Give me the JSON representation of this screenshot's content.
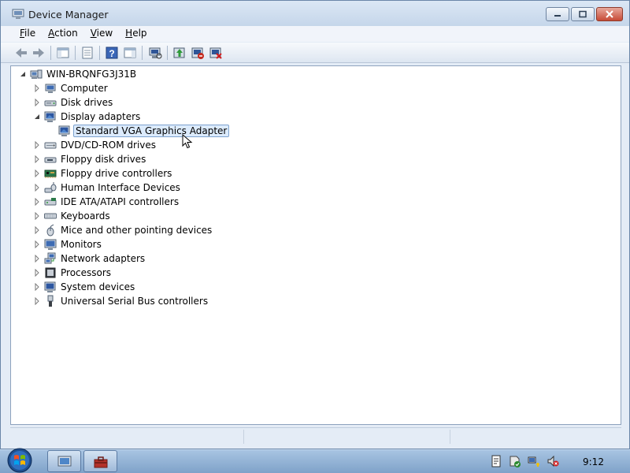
{
  "window": {
    "title": "Device Manager",
    "icon": "device-manager-icon"
  },
  "menu": [
    {
      "label": "File",
      "accel": "F",
      "rest": "ile"
    },
    {
      "label": "Action",
      "accel": "A",
      "rest": "ction"
    },
    {
      "label": "View",
      "accel": "V",
      "rest": "iew"
    },
    {
      "label": "Help",
      "accel": "H",
      "rest": "elp"
    }
  ],
  "toolbar": {
    "buttons": [
      "back-icon",
      "forward-icon",
      "show-hide-console-tree-icon",
      "properties-icon",
      "help-icon",
      "show-hide-action-pane-icon",
      "scan-hardware-icon",
      "update-driver-icon",
      "disable-device-icon",
      "uninstall-device-icon"
    ]
  },
  "tree": {
    "root": "WIN-BRQNFG3J31B",
    "categories": [
      {
        "label": "Computer",
        "expanded": false,
        "icon": "computer-icon"
      },
      {
        "label": "Disk drives",
        "expanded": false,
        "icon": "disk-drive-icon"
      },
      {
        "label": "Display adapters",
        "expanded": true,
        "icon": "display-adapter-icon",
        "children": [
          {
            "label": "Standard VGA Graphics Adapter",
            "selected": true,
            "icon": "display-adapter-icon"
          }
        ]
      },
      {
        "label": "DVD/CD-ROM drives",
        "expanded": false,
        "icon": "dvd-drive-icon"
      },
      {
        "label": "Floppy disk drives",
        "expanded": false,
        "icon": "floppy-drive-icon"
      },
      {
        "label": "Floppy drive controllers",
        "expanded": false,
        "icon": "floppy-controller-icon"
      },
      {
        "label": "Human Interface Devices",
        "expanded": false,
        "icon": "hid-icon"
      },
      {
        "label": "IDE ATA/ATAPI controllers",
        "expanded": false,
        "icon": "ide-controller-icon"
      },
      {
        "label": "Keyboards",
        "expanded": false,
        "icon": "keyboard-icon"
      },
      {
        "label": "Mice and other pointing devices",
        "expanded": false,
        "icon": "mouse-icon"
      },
      {
        "label": "Monitors",
        "expanded": false,
        "icon": "monitor-icon"
      },
      {
        "label": "Network adapters",
        "expanded": false,
        "icon": "network-adapter-icon"
      },
      {
        "label": "Processors",
        "expanded": false,
        "icon": "processor-icon"
      },
      {
        "label": "System devices",
        "expanded": false,
        "icon": "system-devices-icon"
      },
      {
        "label": "Universal Serial Bus controllers",
        "expanded": false,
        "icon": "usb-icon"
      }
    ]
  },
  "taskbar": {
    "clock": "9:12",
    "tasks": [
      "server-manager-icon",
      "toolbox-icon"
    ],
    "tray": [
      "notes-icon",
      "action-center-icon",
      "network-icon",
      "volume-muted-icon"
    ]
  }
}
